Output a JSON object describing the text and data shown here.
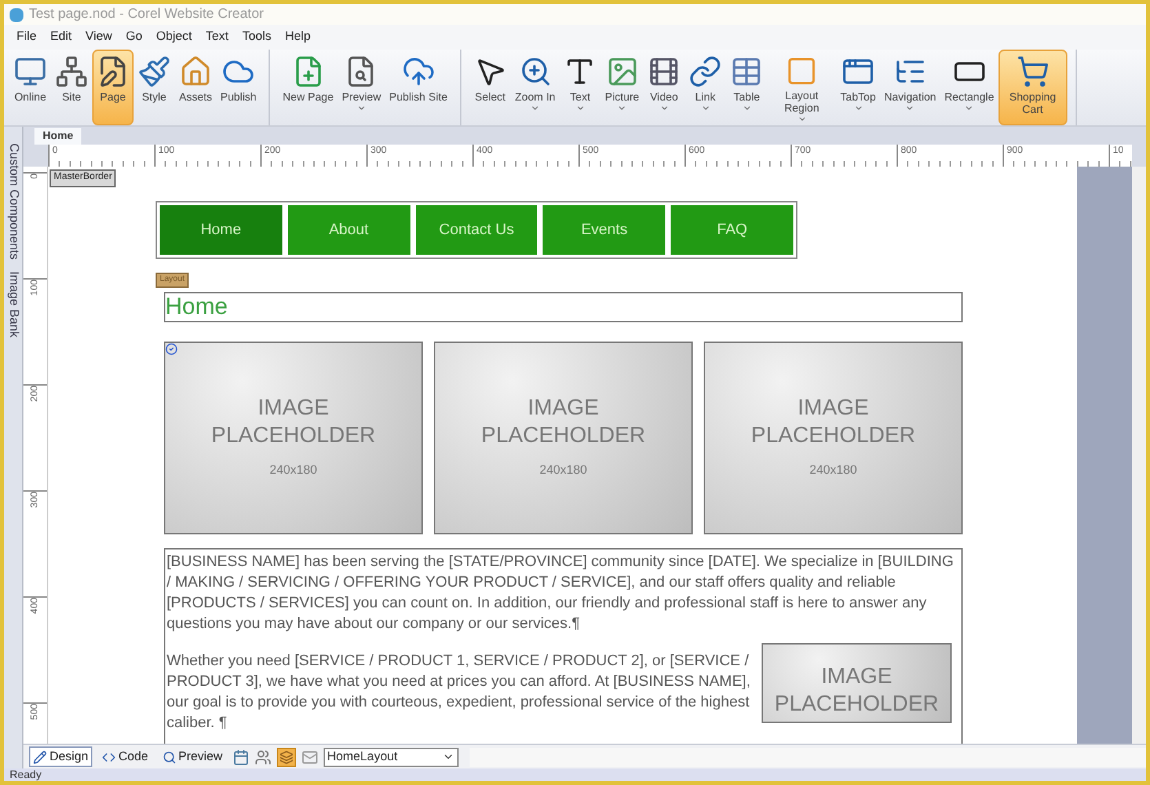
{
  "window": {
    "title": "Test page.nod - Corel Website Creator"
  },
  "menu": [
    "File",
    "Edit",
    "View",
    "Go",
    "Object",
    "Text",
    "Tools",
    "Help"
  ],
  "toolbar_groups": [
    {
      "items": [
        {
          "label": "Online",
          "selected": false,
          "dropdown": false
        },
        {
          "label": "Site",
          "selected": false,
          "dropdown": false
        },
        {
          "label": "Page",
          "selected": true,
          "dropdown": false
        },
        {
          "label": "Style",
          "selected": false,
          "dropdown": false
        },
        {
          "label": "Assets",
          "selected": false,
          "dropdown": false
        },
        {
          "label": "Publish",
          "selected": false,
          "dropdown": false
        }
      ]
    },
    {
      "items": [
        {
          "label": "New Page",
          "selected": false,
          "dropdown": false
        },
        {
          "label": "Preview",
          "selected": false,
          "dropdown": true
        },
        {
          "label": "Publish Site",
          "selected": false,
          "dropdown": false
        }
      ]
    },
    {
      "items": [
        {
          "label": "Select",
          "selected": false,
          "dropdown": false
        },
        {
          "label": "Zoom In",
          "selected": false,
          "dropdown": true
        },
        {
          "label": "Text",
          "selected": false,
          "dropdown": true
        },
        {
          "label": "Picture",
          "selected": false,
          "dropdown": true
        },
        {
          "label": "Video",
          "selected": false,
          "dropdown": true
        },
        {
          "label": "Link",
          "selected": false,
          "dropdown": true
        },
        {
          "label": "Table",
          "selected": false,
          "dropdown": true
        },
        {
          "label": "Layout Region",
          "selected": false,
          "dropdown": true
        },
        {
          "label": "TabTop",
          "selected": false,
          "dropdown": true
        },
        {
          "label": "Navigation",
          "selected": false,
          "dropdown": true
        },
        {
          "label": "Rectangle",
          "selected": false,
          "dropdown": true
        },
        {
          "label": "Shopping Cart",
          "selected": true,
          "dropdown": false
        }
      ]
    }
  ],
  "side_tabs": [
    "Custom Components",
    "Image Bank"
  ],
  "document_tabs": [
    {
      "label": "Home",
      "selected": true
    }
  ],
  "ruler": {
    "horizontal": [
      "0",
      "100",
      "200",
      "300",
      "400",
      "500",
      "600",
      "700",
      "800",
      "900",
      "10"
    ],
    "vertical": [
      "0",
      "100",
      "200",
      "300",
      "400",
      "500"
    ]
  },
  "canvas": {
    "master_border_tag": "MasterBorder",
    "layout_tag": "Layout",
    "heading": "Home",
    "nav": [
      {
        "label": "Home",
        "selected": true
      },
      {
        "label": "About",
        "selected": false
      },
      {
        "label": "Contact Us",
        "selected": false
      },
      {
        "label": "Events",
        "selected": false
      },
      {
        "label": "FAQ",
        "selected": false
      }
    ],
    "image_placeholders": [
      {
        "lines": [
          "IMAGE",
          "PLACEHOLDER"
        ],
        "size": "240x180"
      },
      {
        "lines": [
          "IMAGE",
          "PLACEHOLDER"
        ],
        "size": "240x180"
      },
      {
        "lines": [
          "IMAGE",
          "PLACEHOLDER"
        ],
        "size": "240x180"
      }
    ],
    "paragraphs": [
      "[BUSINESS NAME] has been serving the [STATE/PROVINCE] community since [DATE]. We specialize in [BUILDING / MAKING / SERVICING / OFFERING YOUR PRODUCT / SERVICE], and our staff offers quality and reliable [PRODUCTS / SERVICES] you can count on. In addition, our friendly and professional staff is here to answer any questions you may have about our company or our services.¶",
      "Whether you need [SERVICE / PRODUCT 1, SERVICE / PRODUCT 2], or [SERVICE / PRODUCT 3], we have what you need at prices you can afford. At [BUSINESS NAME], our goal is to provide you with courteous, expedient, professional service of the highest caliber. ¶"
    ],
    "inline_placeholder": {
      "lines": [
        "IMAGE",
        "PLACEHOLDER"
      ]
    }
  },
  "view_tabs": [
    {
      "label": "Design",
      "selected": true
    },
    {
      "label": "Code",
      "selected": false
    },
    {
      "label": "Preview",
      "selected": false
    }
  ],
  "layout_select": {
    "value": "HomeLayout"
  },
  "status_bar": {
    "text": "Ready"
  }
}
